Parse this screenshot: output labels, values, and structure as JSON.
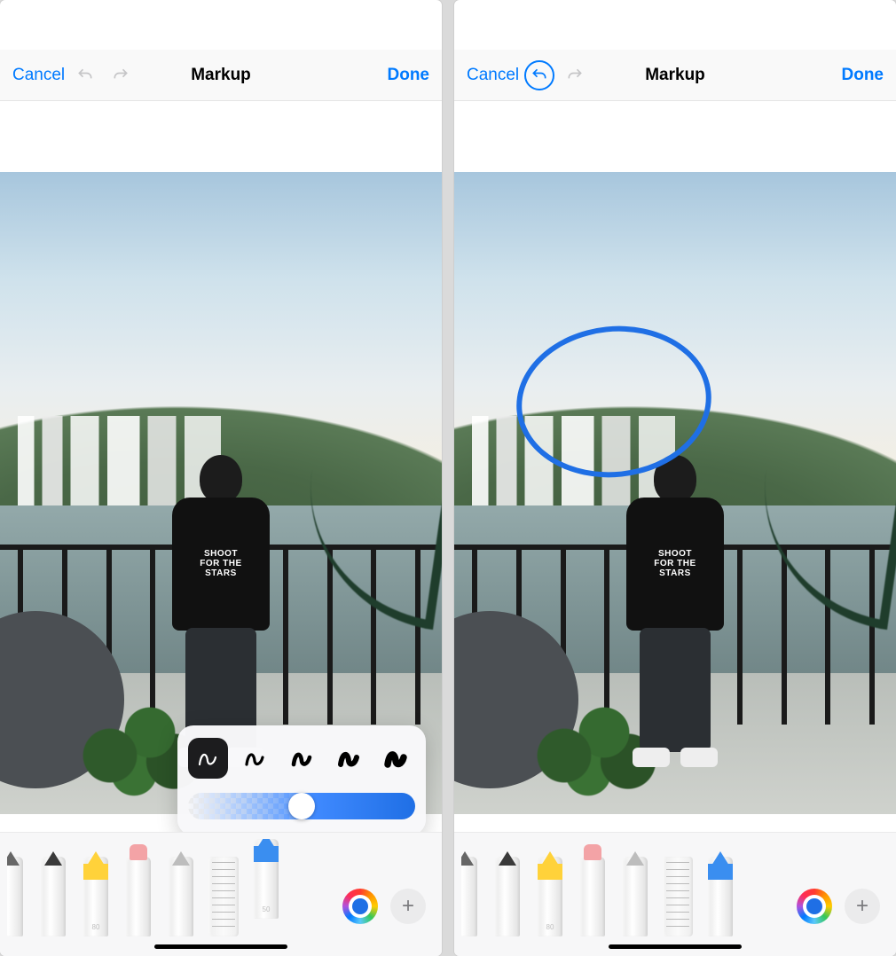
{
  "screens": [
    {
      "id": "left",
      "nav": {
        "cancel": "Cancel",
        "title": "Markup",
        "done": "Done",
        "undo_enabled": false,
        "redo_enabled": false
      },
      "shirt_text": "SHOOT\nFOR THE\nSTARS",
      "has_annotation": false,
      "popover": {
        "visible": true,
        "selected_stroke_index": 0,
        "opacity_percent": 50
      },
      "toolbar": {
        "tools": [
          {
            "name": "pen",
            "tip_color": "#666",
            "band_color": "",
            "label": "",
            "raised": false,
            "half": true
          },
          {
            "name": "fineliner",
            "tip_color": "#3a3a3a",
            "band_color": "",
            "label": "",
            "raised": false
          },
          {
            "name": "highlighter",
            "tip_color": "#ffd23a",
            "band_color": "#ffd23a",
            "label": "80",
            "raised": false
          },
          {
            "name": "eraser",
            "tip_color": "#f3a3a6",
            "band_color": "",
            "label": "",
            "raised": false,
            "cap": "#f3a3a6"
          },
          {
            "name": "pencil",
            "tip_color": "#bdbdbd",
            "band_color": "",
            "label": "",
            "raised": false
          },
          {
            "name": "ruler",
            "is_ruler": true
          },
          {
            "name": "crayon",
            "tip_color": "#3a8ef0",
            "band_color": "#3a8ef0",
            "label": "50",
            "raised": true
          }
        ],
        "selected_color": "#1f6fe5"
      }
    },
    {
      "id": "right",
      "nav": {
        "cancel": "Cancel",
        "title": "Markup",
        "done": "Done",
        "undo_enabled": true,
        "redo_enabled": false
      },
      "shirt_text": "SHOOT\nFOR THE\nSTARS",
      "has_annotation": true,
      "popover": {
        "visible": false
      },
      "toolbar": {
        "tools": [
          {
            "name": "pen",
            "tip_color": "#666",
            "band_color": "",
            "label": "",
            "raised": false,
            "half": true
          },
          {
            "name": "fineliner",
            "tip_color": "#3a3a3a",
            "band_color": "",
            "label": "",
            "raised": false
          },
          {
            "name": "highlighter",
            "tip_color": "#ffd23a",
            "band_color": "#ffd23a",
            "label": "80",
            "raised": false
          },
          {
            "name": "eraser",
            "tip_color": "#f3a3a6",
            "band_color": "",
            "label": "",
            "raised": false,
            "cap": "#f3a3a6"
          },
          {
            "name": "pencil",
            "tip_color": "#bdbdbd",
            "band_color": "",
            "label": "",
            "raised": false
          },
          {
            "name": "ruler",
            "is_ruler": true
          },
          {
            "name": "crayon",
            "tip_color": "#3a8ef0",
            "band_color": "#3a8ef0",
            "label": "",
            "raised": false
          }
        ],
        "selected_color": "#1f6fe5"
      }
    }
  ]
}
